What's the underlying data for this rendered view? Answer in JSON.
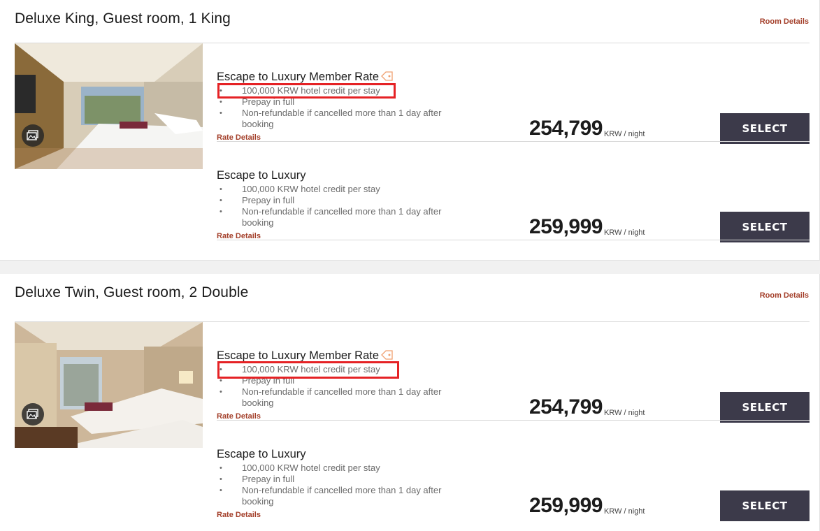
{
  "rooms": [
    {
      "title": "Deluxe King, Guest room, 1 King",
      "room_details_label": "Room Details",
      "rates": [
        {
          "name": "Escape to Luxury Member Rate",
          "member": true,
          "perks": [
            "100,000 KRW hotel credit per stay",
            "Prepay in full",
            "Non-refundable if cancelled more than 1 day after booking"
          ],
          "rate_details_label": "Rate Details",
          "price": "254,799",
          "unit": "KRW / night",
          "select_label": "SELECT",
          "highlighted_perk": 0
        },
        {
          "name": "Escape to Luxury",
          "member": false,
          "perks": [
            "100,000 KRW hotel credit per stay",
            "Prepay in full",
            "Non-refundable if cancelled more than 1 day after booking"
          ],
          "rate_details_label": "Rate Details",
          "price": "259,999",
          "unit": "KRW / night",
          "select_label": "SELECT"
        }
      ]
    },
    {
      "title": "Deluxe Twin, Guest room, 2 Double",
      "room_details_label": "Room Details",
      "rates": [
        {
          "name": "Escape to Luxury Member Rate",
          "member": true,
          "perks": [
            "100,000 KRW hotel credit per stay",
            "Prepay in full",
            "Non-refundable if cancelled more than 1 day after booking"
          ],
          "rate_details_label": "Rate Details",
          "price": "254,799",
          "unit": "KRW / night",
          "select_label": "SELECT",
          "highlighted_perk": 0
        },
        {
          "name": "Escape to Luxury",
          "member": false,
          "perks": [
            "100,000 KRW hotel credit per stay",
            "Prepay in full",
            "Non-refundable if cancelled more than 1 day after booking"
          ],
          "rate_details_label": "Rate Details",
          "price": "259,999",
          "unit": "KRW / night",
          "select_label": "SELECT"
        }
      ]
    }
  ],
  "colors": {
    "accent": "#a4402b",
    "select_button": "#3c3a4a",
    "highlight_box": "#e52225",
    "member_tag": "#f0a070"
  },
  "icons": {
    "gallery": "gallery-icon",
    "member_tag": "tag-icon"
  }
}
